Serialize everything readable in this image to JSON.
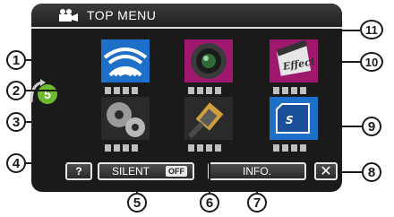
{
  "header": {
    "title": "TOP MENU",
    "icon": "camcorder-icon"
  },
  "tiles": [
    {
      "name": "wireless-tile",
      "icon": "wifi-icon"
    },
    {
      "name": "recording-settings-tile",
      "icon": "lens-icon"
    },
    {
      "name": "effect-tile",
      "icon": "effect-clapper-icon"
    },
    {
      "name": "common-settings-tile",
      "icon": "gears-icon"
    },
    {
      "name": "connection-settings-tile",
      "icon": "hdmi-cable-icon"
    },
    {
      "name": "media-settings-tile",
      "icon": "sd-card-icon"
    }
  ],
  "sidebar": {
    "shortcut_icon": "five-arrow-icon",
    "shortcut_text": "5"
  },
  "buttons": {
    "help": "?",
    "silent": "SILENT",
    "silent_state": "OFF",
    "info": "INFO.",
    "close": "✕"
  },
  "callouts": [
    "1",
    "2",
    "3",
    "4",
    "5",
    "6",
    "7",
    "8",
    "9",
    "10",
    "11"
  ],
  "colors": {
    "screen_bg": "#1a1a1a",
    "tile_blue": "#1e6fc8",
    "tile_magenta": "#a0186e",
    "five_green": "#6dbb2c"
  }
}
